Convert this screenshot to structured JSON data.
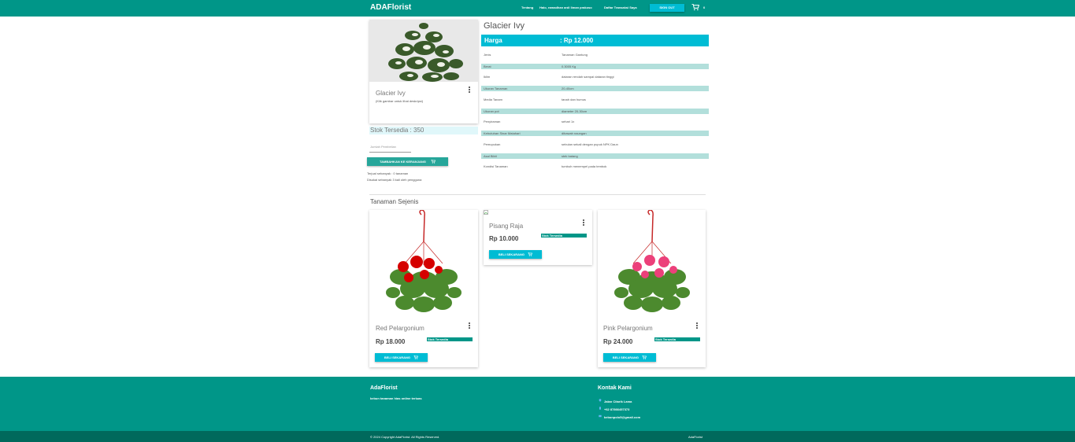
{
  "navbar": {
    "brand": "ADAFlorist",
    "links": [
      "Tentang",
      "Halo, ramadhan ardi liman prakoso",
      "Daftar Transaksi Saya"
    ],
    "signout": "SIGN OUT",
    "cart_count": "0",
    "cart_icon": "shopping-cart-icon"
  },
  "product": {
    "name": "Glacier Ivy",
    "hint": "(Klik gambar untuk lihat deskripsi)",
    "stock": "Stok Tersedia : 350",
    "qty_label": "Jumlah Pembelian",
    "add_to_cart": "TAMBAHKAN KE KERANJANG",
    "sold": "Terjual sebanyak : 0 tanaman",
    "liked": "Disukai sebanyak 3 kali oleh pengguna",
    "price_label": "Harga",
    "price_value": ": Rp 12.000",
    "specs": [
      {
        "k": "Jenis",
        "v": "Tanaman Gantung"
      },
      {
        "k": "Berat",
        "v": "0.3005 Kg"
      },
      {
        "k": "Iklim",
        "v": "dataran rendah sampai dataran tinggi"
      },
      {
        "k": "Ukuran Tanaman",
        "v": "20-40cm"
      },
      {
        "k": "Media Tanam",
        "v": "tanah dan humus"
      },
      {
        "k": "Ukuran pot",
        "v": "diameter 20-30cm"
      },
      {
        "k": "Penyiraman",
        "v": "sehari 1x"
      },
      {
        "k": "Kebutuhan Sinar Matahari",
        "v": "dibawah naungan"
      },
      {
        "k": "Pemupukan",
        "v": "sebulan sekali dengan pupuk NPK Daun"
      },
      {
        "k": "Asal Bibit",
        "v": "stek batang"
      },
      {
        "k": "Kondisi Tanaman",
        "v": "tumbuh menempel pada tembok"
      }
    ]
  },
  "similar": {
    "title": "Tanaman Sejenis",
    "items": [
      {
        "name": "Red Pelargonium",
        "price": "Rp 18.000",
        "stock": "Stok Tersedia",
        "buy": "BELI SEKARANG"
      },
      {
        "name": "Pisang Raja",
        "price": "Rp 10.000",
        "stock": "Stok Tersedia",
        "buy": "BELI SEKARANG"
      },
      {
        "name": "Pink Pelargonium",
        "price": "Rp 24.000",
        "stock": "Stok Tersedia",
        "buy": "BELI SEKARANG"
      }
    ]
  },
  "footer": {
    "brand": "AdaFlorist",
    "tagline": "kebun tanaman hias online terluas",
    "contact_title": "Kontak Kami",
    "address": "Jalan Citarik Lama",
    "phone": "+62 87866457373",
    "email": "kebonpolo5@gmail.com",
    "copyright": "© 2024 Copyright AdaFlorist. All Rights Reserved.",
    "copyright_brand": "AdaFlorist"
  },
  "colors": {
    "primary": "#009688",
    "accent": "#00bcd4",
    "stripe": "#b2dfdb",
    "footer_dark": "#00695c"
  }
}
